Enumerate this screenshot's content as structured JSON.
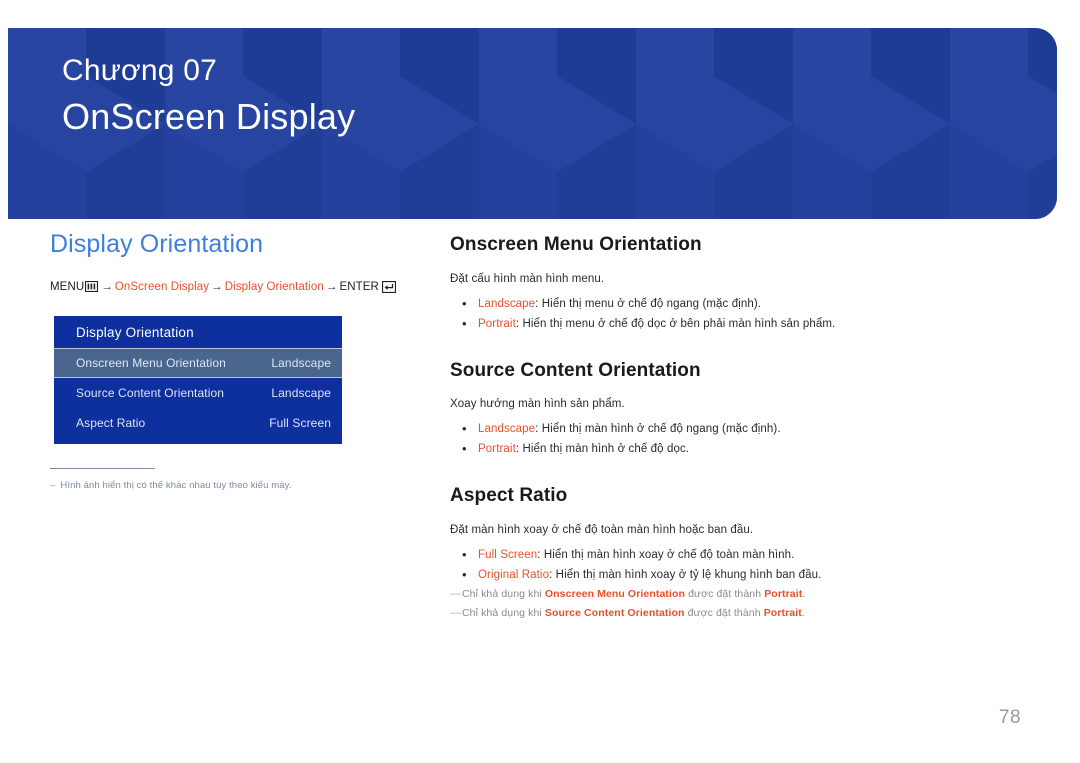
{
  "header": {
    "chapter_label": "Chương 07",
    "chapter_title": "OnScreen Display",
    "background_color": "#23409a"
  },
  "left": {
    "section_title": "Display Orientation",
    "menu_path": {
      "menu_label": "MENU",
      "menu_icon": "menu-bars-icon",
      "arrow": "→",
      "step1": "OnScreen Display",
      "step2": "Display Orientation",
      "enter_label": "ENTER",
      "enter_icon": "enter-return-icon",
      "highlight_color": "#e8502b"
    },
    "osd": {
      "title": "Display Orientation",
      "rows": [
        {
          "label": "Onscreen Menu Orientation",
          "value": "Landscape",
          "selected": true
        },
        {
          "label": "Source Content Orientation",
          "value": "Landscape",
          "selected": false
        },
        {
          "label": "Aspect Ratio",
          "value": "Full Screen",
          "selected": false
        }
      ],
      "background_color": "#0e2f9e",
      "selected_color": "#4a668e"
    },
    "note": {
      "dash": "–",
      "text": "Hình ảnh hiển thị có thể khác nhau tùy theo kiểu máy."
    }
  },
  "right": {
    "sections": [
      {
        "title": "Onscreen Menu Orientation",
        "description": "Đặt cấu hình màn hình menu.",
        "bullets": [
          {
            "option": "Landscape",
            "text": ": Hiển thị menu ở chế độ ngang (mặc định)."
          },
          {
            "option": "Portrait",
            "text": ": Hiển thị menu ở chế độ dọc ở bên phải màn hình sản phẩm."
          }
        ],
        "notes": []
      },
      {
        "title": "Source Content Orientation",
        "description": "Xoay hướng màn hình sản phẩm.",
        "bullets": [
          {
            "option": "Landscape",
            "text": ": Hiển thị màn hình ở chế độ ngang (mặc định)."
          },
          {
            "option": "Portrait",
            "text": ": Hiển thị màn hình ở chế độ dọc."
          }
        ],
        "notes": []
      },
      {
        "title": "Aspect Ratio",
        "description": "Đặt màn hình xoay ở chế độ toàn màn hình hoặc ban đầu.",
        "bullets": [
          {
            "option": "Full Screen",
            "text": ": Hiển thị màn hình xoay ở chế độ toàn màn hình."
          },
          {
            "option": "Original Ratio",
            "text": ": Hiển thị màn hình xoay ở tỷ lệ khung hình ban đầu."
          }
        ],
        "notes": [
          {
            "dash": "―",
            "pre": "Chỉ khả dụng khi ",
            "ref": "Onscreen Menu Orientation",
            "mid": " được đặt thành ",
            "val": "Portrait",
            "post": "."
          },
          {
            "dash": "―",
            "pre": "Chỉ khả dụng khi ",
            "ref": "Source Content Orientation",
            "mid": " được đặt thành ",
            "val": "Portrait",
            "post": "."
          }
        ]
      }
    ],
    "bullet_glyph": "•"
  },
  "footer": {
    "page_number": "78"
  }
}
